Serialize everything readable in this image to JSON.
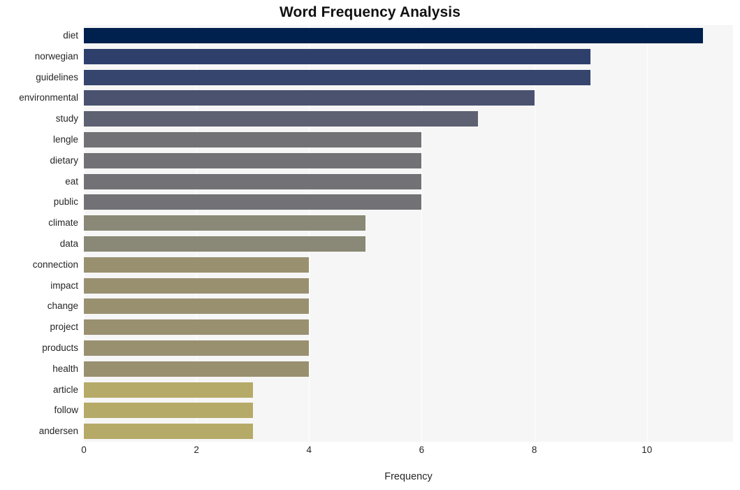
{
  "chart_data": {
    "type": "bar",
    "orientation": "horizontal",
    "title": "Word Frequency Analysis",
    "xlabel": "Frequency",
    "ylabel": "",
    "categories": [
      "diet",
      "norwegian",
      "guidelines",
      "environmental",
      "study",
      "lengle",
      "dietary",
      "eat",
      "public",
      "climate",
      "data",
      "connection",
      "impact",
      "change",
      "project",
      "products",
      "health",
      "article",
      "follow",
      "andersen"
    ],
    "values": [
      11,
      9,
      9,
      8,
      7,
      6,
      6,
      6,
      6,
      5,
      5,
      4,
      4,
      4,
      4,
      4,
      4,
      3,
      3,
      3
    ],
    "bar_colors": [
      "#00204d",
      "#2e3f6c",
      "#35456e",
      "#4a5270",
      "#5e6172",
      "#727276",
      "#727276",
      "#727276",
      "#727276",
      "#8a8876",
      "#8a8876",
      "#999070",
      "#999070",
      "#999070",
      "#999070",
      "#999070",
      "#999070",
      "#b5aa68",
      "#b5aa68",
      "#b5aa68"
    ],
    "xlim": [
      0,
      11.53
    ],
    "xticks": [
      0,
      2,
      4,
      6,
      8,
      10
    ],
    "xtick_labels": [
      "0",
      "2",
      "4",
      "6",
      "8",
      "10"
    ],
    "grid": true,
    "grid_axis": "x",
    "legend": null,
    "plot_background": "#f6f6f6",
    "figure_background": "#ffffff",
    "colormap": "cividis"
  }
}
